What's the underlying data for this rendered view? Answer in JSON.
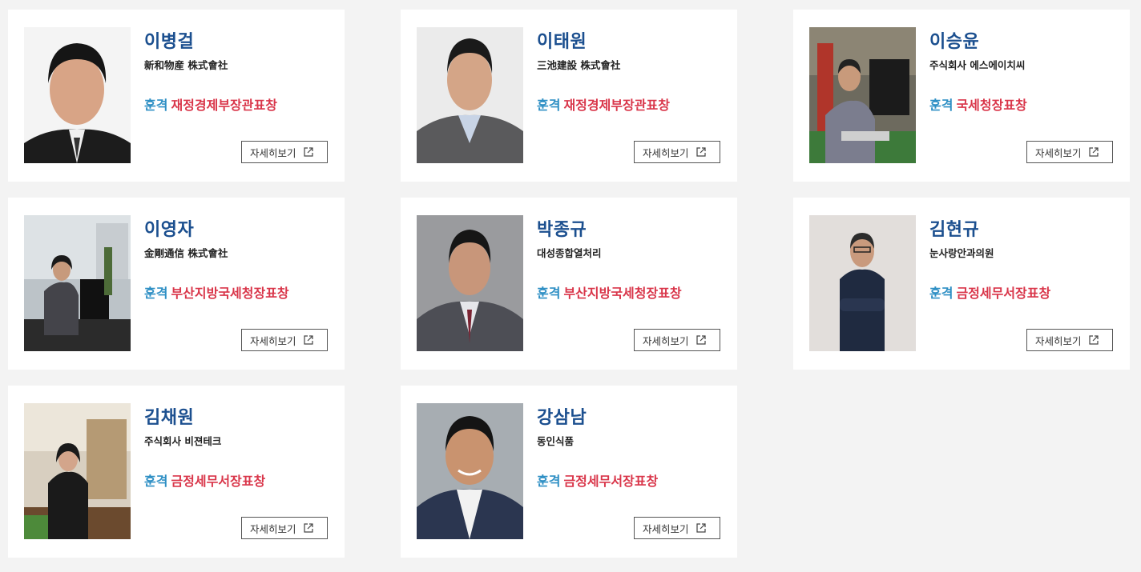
{
  "detail_label": "자세히보기",
  "award_type": "훈격",
  "cards": [
    {
      "name": "이병걸",
      "company": "新和物産 株式會社",
      "award": "재정경제부장관표창"
    },
    {
      "name": "이태원",
      "company": "三池建設 株式會社",
      "award": "재정경제부장관표창"
    },
    {
      "name": "이승윤",
      "company": "주식회사 에스에이치씨",
      "award": "국세청장표창"
    },
    {
      "name": "이영자",
      "company": "金剛通信 株式會社",
      "award": "부산지방국세청장표창"
    },
    {
      "name": "박종규",
      "company": "대성종합열처리",
      "award": "부산지방국세청장표창"
    },
    {
      "name": "김현규",
      "company": "눈사랑안과의원",
      "award": "금정세무서장표창"
    },
    {
      "name": "김채원",
      "company": "주식회사 비젼테크",
      "award": "금정세무서장표창"
    },
    {
      "name": "강삼남",
      "company": "동인식품",
      "award": "금정세무서장표창"
    }
  ],
  "colors": {
    "name": "#1b4f8f",
    "award_type": "#2e8fc4",
    "award_name": "#d9364a",
    "page_bg": "#f3f3f3"
  },
  "icons": {
    "detail": "external-link-icon"
  }
}
